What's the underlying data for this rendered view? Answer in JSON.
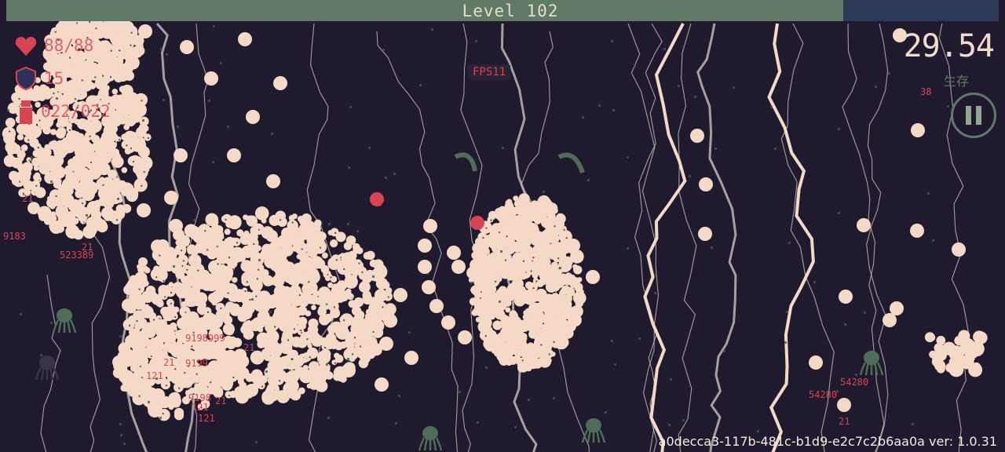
{
  "hud": {
    "level_label": "Level 102",
    "hp_text": "88/88",
    "shield_text": "15",
    "ammo_text": "022/022",
    "fps_text": "FPS11",
    "timer_text": "29.54",
    "survive_label": "生存",
    "small_counter": "38",
    "footer_text": "a0decca3-117b-481c-b1d9-e2c7c2b6aa0a ver: 1.0.31"
  },
  "damage_numbers": [
    "21",
    "9183",
    "523389",
    "21",
    "9198999",
    "21",
    "9199",
    "21",
    "121",
    "9198",
    "121",
    "21",
    "121",
    "54280",
    "54280",
    "21"
  ],
  "colors": {
    "background": "#201a2e",
    "bullet": "#f4d9c6",
    "hud_red": "#d94452",
    "bar_green": "#5f7a66",
    "bar_blue": "#2a3a57",
    "plant_green": "#3d5a45"
  },
  "icons": [
    "heart-icon",
    "shield-icon",
    "ammo-icon",
    "pause-icon"
  ]
}
